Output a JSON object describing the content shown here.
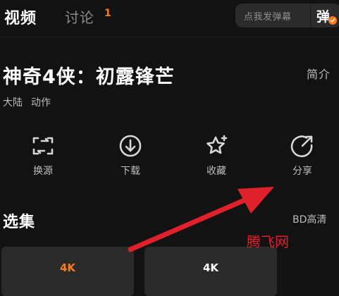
{
  "tabs": {
    "video": "视频",
    "discuss": "讨论",
    "discuss_count": "1"
  },
  "danmaku": {
    "placeholder": "点我发弹幕",
    "button": "弹"
  },
  "show": {
    "title": "神奇4侠：初露锋芒",
    "intro_link": "简介",
    "region": "大陆",
    "genre": "动作"
  },
  "actions": [
    {
      "label": "换源",
      "icon": "switch-source-icon"
    },
    {
      "label": "下载",
      "icon": "download-icon"
    },
    {
      "label": "收藏",
      "icon": "favorite-star-icon"
    },
    {
      "label": "分享",
      "icon": "share-icon"
    }
  ],
  "episodes": {
    "title": "选集",
    "quality": "BD高清",
    "items": [
      {
        "label": "4K",
        "selected": true
      },
      {
        "label": "4K",
        "selected": false
      }
    ]
  },
  "watermark": "腾飞网",
  "colors": {
    "background": "#121212",
    "accent": "#ff7a1a",
    "annotation_arrow": "#e0202a"
  }
}
